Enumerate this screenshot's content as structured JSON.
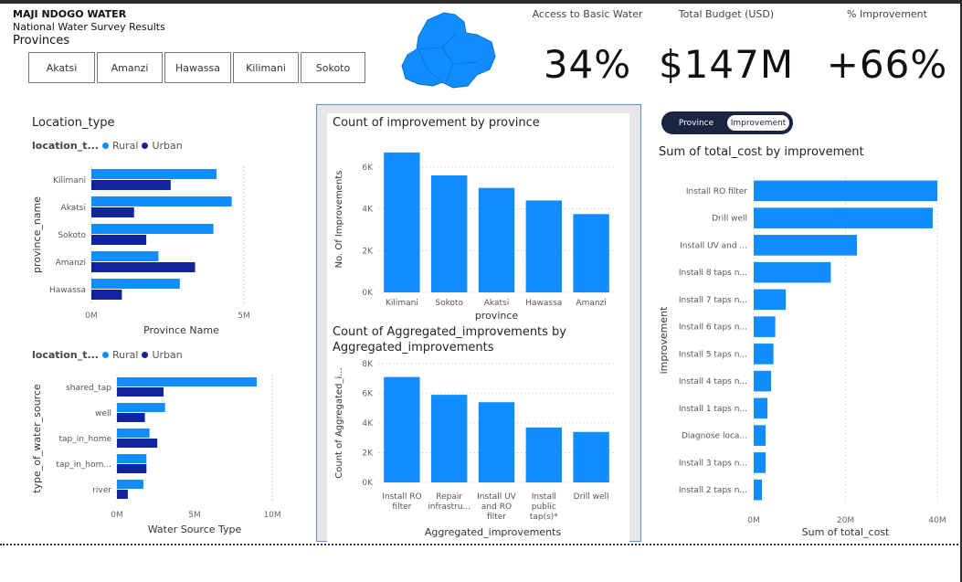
{
  "header": {
    "title": "MAJI NDOGO WATER",
    "subtitle": "National Water Survey Results",
    "provinces_label": "Provinces"
  },
  "province_slicer": [
    "Akatsi",
    "Amanzi",
    "Hawassa",
    "Kilimani",
    "Sokoto"
  ],
  "kpis": [
    {
      "label": "Access to Basic Water",
      "value": "34%"
    },
    {
      "label": "Total Budget (USD)",
      "value": "$147M"
    },
    {
      "label": "% Improvement",
      "value": "+66%"
    }
  ],
  "colors": {
    "rural": "#118DFF",
    "urban": "#12239E",
    "bar": "#118DFF",
    "toggle_bg": "#1B2440",
    "map": "#118DFF"
  },
  "toggle": {
    "options": [
      "Province",
      "Improvement"
    ],
    "selected": "Improvement"
  },
  "location_type_title": "Location_type",
  "legend": {
    "field": "location_t...",
    "rural": "Rural",
    "urban": "Urban"
  },
  "chart_data": [
    {
      "type": "bar",
      "orientation": "horizontal",
      "title": "",
      "categories": [
        "Kilimani",
        "Akatsi",
        "Sokoto",
        "Amanzi",
        "Hawassa"
      ],
      "series": [
        {
          "name": "Rural",
          "values": [
            4100000,
            4600000,
            4000000,
            2200000,
            2900000
          ]
        },
        {
          "name": "Urban",
          "values": [
            2600000,
            1400000,
            1800000,
            3400000,
            1000000
          ]
        }
      ],
      "xlabel": "Province Name",
      "ylabel": "province_name",
      "xticks": [
        "0M",
        "5M"
      ],
      "xlim": [
        0,
        5000000
      ]
    },
    {
      "type": "bar",
      "orientation": "horizontal",
      "title": "",
      "categories": [
        "shared_tap",
        "well",
        "tap_in_home",
        "tap_in_hom...",
        "river"
      ],
      "series": [
        {
          "name": "Rural",
          "values": [
            9000000,
            3100000,
            2100000,
            1900000,
            1700000
          ]
        },
        {
          "name": "Urban",
          "values": [
            3000000,
            1800000,
            2600000,
            1900000,
            700000
          ]
        }
      ],
      "xlabel": "Water Source Type",
      "ylabel": "type_of_water_source",
      "xticks": [
        "0M",
        "5M",
        "10M"
      ],
      "xlim": [
        0,
        10000000
      ]
    },
    {
      "type": "bar",
      "title": "Count of improvement by province",
      "categories": [
        "Kilimani",
        "Sokoto",
        "Akatsi",
        "Hawassa",
        "Amanzi"
      ],
      "values": [
        6700,
        5600,
        5000,
        4400,
        3750
      ],
      "xlabel": "province",
      "ylabel": "No. Of Improvements",
      "yticks": [
        "0K",
        "2K",
        "4K",
        "6K"
      ],
      "ylim": [
        0,
        7000
      ]
    },
    {
      "type": "bar",
      "title": "Count of Aggregated_improvements by Aggregated_improvements",
      "categories": [
        "Install RO filter",
        "Repair infrastru...",
        "Install UV and RO filter",
        "Install public tap(s)*",
        "Drill well"
      ],
      "values": [
        7100,
        5900,
        5400,
        3700,
        3400
      ],
      "xlabel": "Aggregated_improvements",
      "ylabel": "Count of Aggregated_i...",
      "yticks": [
        "0K",
        "2K",
        "4K",
        "6K",
        "8K"
      ],
      "ylim": [
        0,
        8000
      ]
    },
    {
      "type": "bar",
      "orientation": "horizontal",
      "title": "Sum of total_cost by improvement",
      "categories": [
        "Install RO filter",
        "Drill well",
        "Install UV and ...",
        "Install 8 taps n...",
        "Install 7 taps n...",
        "Install 6 taps n...",
        "Install 5 taps n...",
        "Install 4 taps n...",
        "Install 1 taps n...",
        "Diagnose loca...",
        "Install 3 taps n...",
        "Install 2 taps n..."
      ],
      "values": [
        40000000,
        39000000,
        22500000,
        16800000,
        7000000,
        4700000,
        4300000,
        3800000,
        3000000,
        2600000,
        2600000,
        1800000
      ],
      "xlabel": "Sum of total_cost",
      "ylabel": "improvement",
      "xticks": [
        "0M",
        "20M",
        "40M"
      ],
      "xlim": [
        0,
        40000000
      ]
    }
  ]
}
